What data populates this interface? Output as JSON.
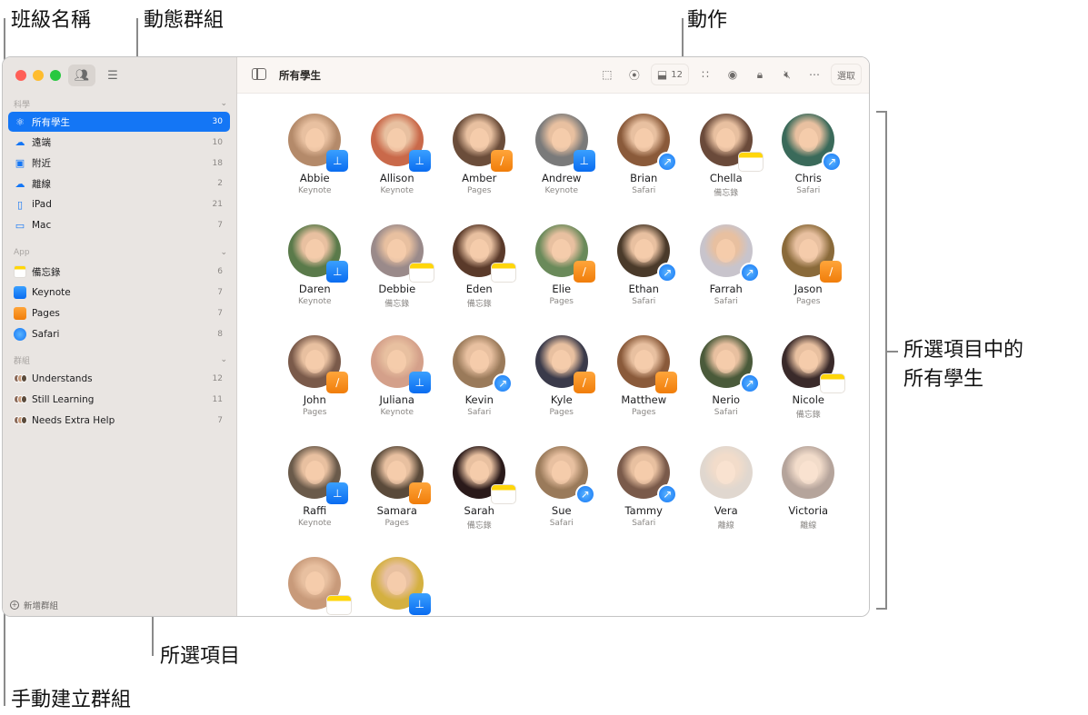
{
  "callouts": {
    "class_name": "班級名稱",
    "smart_groups": "動態群組",
    "actions": "動作",
    "selection": "所選項目",
    "manual_groups": "手動建立群組",
    "all_students_line1": "所選項目中的",
    "all_students_line2": "所有學生"
  },
  "sidebar": {
    "sections": [
      {
        "title": "科學",
        "items": [
          {
            "label": "所有學生",
            "count": "30",
            "icon": "atom-icon",
            "selected": true
          },
          {
            "label": "遠端",
            "count": "10",
            "icon": "cloud-person-icon"
          },
          {
            "label": "附近",
            "count": "18",
            "icon": "person-badge-icon"
          },
          {
            "label": "離線",
            "count": "2",
            "icon": "cloud-slash-icon"
          },
          {
            "label": "iPad",
            "count": "21",
            "icon": "ipad-icon"
          },
          {
            "label": "Mac",
            "count": "7",
            "icon": "laptop-icon"
          }
        ]
      },
      {
        "title": "App",
        "items": [
          {
            "label": "備忘錄",
            "count": "6",
            "icon": "notes-app-icon"
          },
          {
            "label": "Keynote",
            "count": "7",
            "icon": "keynote-app-icon"
          },
          {
            "label": "Pages",
            "count": "7",
            "icon": "pages-app-icon"
          },
          {
            "label": "Safari",
            "count": "8",
            "icon": "safari-app-icon"
          }
        ]
      },
      {
        "title": "群組",
        "items": [
          {
            "label": "Understands",
            "count": "12",
            "icon": "group-avatars-icon"
          },
          {
            "label": "Still Learning",
            "count": "11",
            "icon": "group-avatars-icon"
          },
          {
            "label": "Needs Extra Help",
            "count": "7",
            "icon": "group-avatars-icon"
          }
        ]
      }
    ],
    "add_group_label": "新增群組"
  },
  "toolbar": {
    "title": "所有學生",
    "inbox_count": "12",
    "select_label": "選取",
    "icons": [
      "layers-icon",
      "compass-icon",
      "inbox-icon",
      "grid-circles-icon",
      "eye-slash-icon",
      "lock-icon",
      "mute-icon",
      "more-icon"
    ]
  },
  "students": [
    {
      "name": "Abbie",
      "app": "Keynote",
      "badge": "keynote",
      "color": "#b48a6a"
    },
    {
      "name": "Allison",
      "app": "Keynote",
      "badge": "keynote",
      "color": "#c9694a"
    },
    {
      "name": "Amber",
      "app": "Pages",
      "badge": "pages",
      "color": "#6b4d3a"
    },
    {
      "name": "Andrew",
      "app": "Keynote",
      "badge": "keynote",
      "color": "#7a7a7a"
    },
    {
      "name": "Brian",
      "app": "Safari",
      "badge": "safari",
      "color": "#8a5a3a"
    },
    {
      "name": "Chella",
      "app": "備忘錄",
      "badge": "notes",
      "color": "#6a4a3a"
    },
    {
      "name": "Chris",
      "app": "Safari",
      "badge": "safari",
      "color": "#3a6a5a"
    },
    {
      "name": "Daren",
      "app": "Keynote",
      "badge": "keynote",
      "color": "#5a7a4a"
    },
    {
      "name": "Debbie",
      "app": "備忘錄",
      "badge": "notes",
      "color": "#9a8a8a"
    },
    {
      "name": "Eden",
      "app": "備忘錄",
      "badge": "notes",
      "color": "#5a3a2a"
    },
    {
      "name": "Elie",
      "app": "Pages",
      "badge": "pages",
      "color": "#6a8a5a"
    },
    {
      "name": "Ethan",
      "app": "Safari",
      "badge": "safari",
      "color": "#4a3a2a"
    },
    {
      "name": "Farrah",
      "app": "Safari",
      "badge": "safari",
      "color": "#c8c4cc"
    },
    {
      "name": "Jason",
      "app": "Pages",
      "badge": "pages",
      "color": "#8a6a3a"
    },
    {
      "name": "John",
      "app": "Pages",
      "badge": "pages",
      "color": "#7a5a4a"
    },
    {
      "name": "Juliana",
      "app": "Keynote",
      "badge": "keynote",
      "color": "#d4a08a"
    },
    {
      "name": "Kevin",
      "app": "Safari",
      "badge": "safari",
      "color": "#9a7a5a"
    },
    {
      "name": "Kyle",
      "app": "Pages",
      "badge": "pages",
      "color": "#3a3a4a"
    },
    {
      "name": "Matthew",
      "app": "Pages",
      "badge": "pages",
      "color": "#8a5a3a"
    },
    {
      "name": "Nerio",
      "app": "Safari",
      "badge": "safari",
      "color": "#4a5a3a"
    },
    {
      "name": "Nicole",
      "app": "備忘錄",
      "badge": "notes",
      "color": "#3a2a2a"
    },
    {
      "name": "Raffi",
      "app": "Keynote",
      "badge": "keynote",
      "color": "#6a5a4a"
    },
    {
      "name": "Samara",
      "app": "Pages",
      "badge": "pages",
      "color": "#5a4a3a"
    },
    {
      "name": "Sarah",
      "app": "備忘錄",
      "badge": "notes",
      "color": "#2a1a1a"
    },
    {
      "name": "Sue",
      "app": "Safari",
      "badge": "safari",
      "color": "#9a7a5a"
    },
    {
      "name": "Tammy",
      "app": "Safari",
      "badge": "safari",
      "color": "#7a5a4a"
    },
    {
      "name": "Vera",
      "app": "離線",
      "badge": "",
      "color": "#c8b8a8",
      "offline": true
    },
    {
      "name": "Victoria",
      "app": "離線",
      "badge": "",
      "color": "#7a5a4a",
      "offline": true
    },
    {
      "name": "",
      "app": "",
      "badge": "notes",
      "color": "#c89a7a"
    },
    {
      "name": "",
      "app": "",
      "badge": "keynote",
      "color": "#d4b040"
    }
  ]
}
